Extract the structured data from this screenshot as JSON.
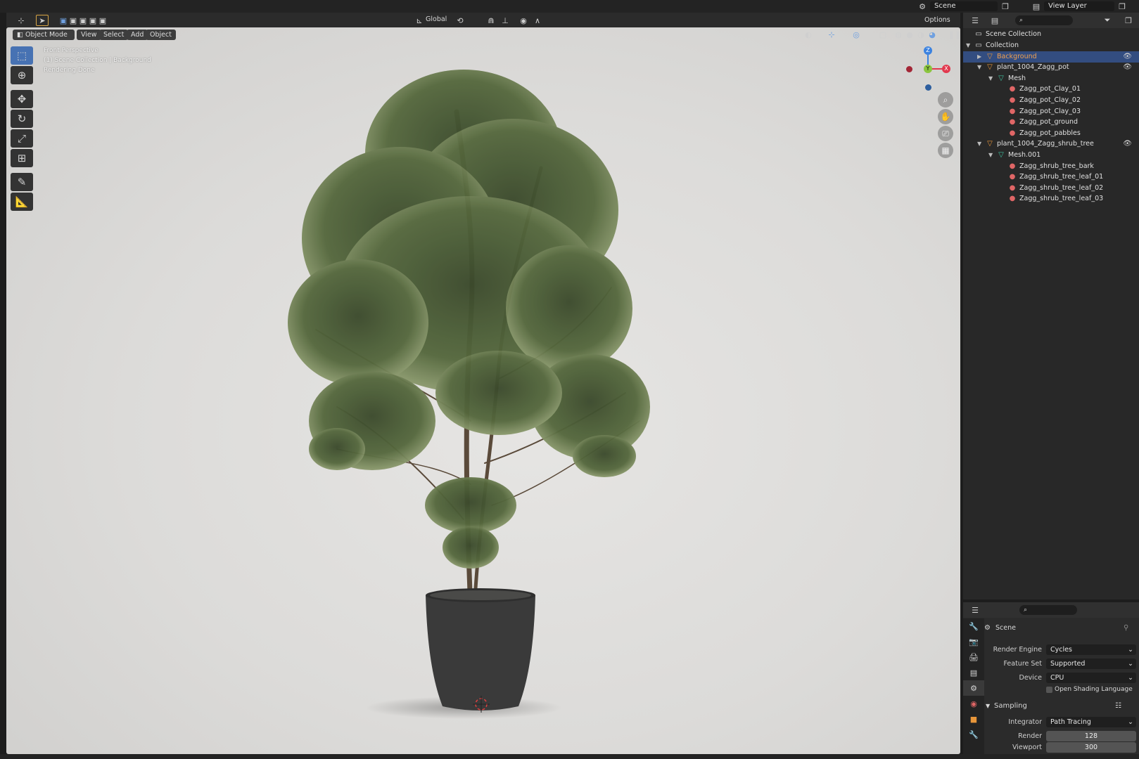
{
  "topbar": {
    "scene_label": "Scene",
    "view_layer_label": "View Layer"
  },
  "viewport_header": {
    "transform_orientation": "Global",
    "options_label": "Options",
    "mode_label": "Object Mode",
    "menus": [
      "View",
      "Select",
      "Add",
      "Object"
    ]
  },
  "viewport_overlay": {
    "view_name": "Front Perspective",
    "context": "(1) Scene Collection | Background",
    "status": "Rendering Done"
  },
  "gizmo": {
    "z": "Z",
    "y": "Y",
    "x": "X"
  },
  "outliner": {
    "root": "Scene Collection",
    "rows": [
      {
        "label": "Collection",
        "icon": "collection-icon",
        "indent": 1,
        "expanded": true
      },
      {
        "label": "Background",
        "icon": "object-icon",
        "indent": 2,
        "expanded": false,
        "selected": true
      },
      {
        "label": "plant_1004_Zagg_pot",
        "icon": "object-icon",
        "indent": 2,
        "expanded": true
      },
      {
        "label": "Mesh",
        "icon": "mesh-icon",
        "indent": 3,
        "expanded": true
      },
      {
        "label": "Zagg_pot_Clay_01",
        "icon": "material-icon",
        "indent": 4
      },
      {
        "label": "Zagg_pot_Clay_02",
        "icon": "material-icon",
        "indent": 4
      },
      {
        "label": "Zagg_pot_Clay_03",
        "icon": "material-icon",
        "indent": 4
      },
      {
        "label": "Zagg_pot_ground",
        "icon": "material-icon",
        "indent": 4
      },
      {
        "label": "Zagg_pot_pabbles",
        "icon": "material-icon",
        "indent": 4
      },
      {
        "label": "plant_1004_Zagg_shrub_tree",
        "icon": "object-icon",
        "indent": 2,
        "expanded": true
      },
      {
        "label": "Mesh.001",
        "icon": "mesh-icon",
        "indent": 3,
        "expanded": true
      },
      {
        "label": "Zagg_shrub_tree_bark",
        "icon": "material-icon",
        "indent": 4
      },
      {
        "label": "Zagg_shrub_tree_leaf_01",
        "icon": "material-icon",
        "indent": 4
      },
      {
        "label": "Zagg_shrub_tree_leaf_02",
        "icon": "material-icon",
        "indent": 4
      },
      {
        "label": "Zagg_shrub_tree_leaf_03",
        "icon": "material-icon",
        "indent": 4
      }
    ]
  },
  "properties": {
    "context_title": "Scene",
    "render_engine_label": "Render Engine",
    "render_engine_value": "Cycles",
    "feature_set_label": "Feature Set",
    "feature_set_value": "Supported",
    "device_label": "Device",
    "device_value": "CPU",
    "osl_label": "Open Shading Language",
    "sampling_label": "Sampling",
    "integrator_label": "Integrator",
    "integrator_value": "Path Tracing",
    "render_label": "Render",
    "render_value": "128",
    "viewport_label": "Viewport",
    "viewport_value": "300"
  },
  "colors": {
    "selection": "#334d80",
    "active_tool": "#4772b3",
    "object_icon": "#e8963a",
    "mesh_icon": "#3fc2a0",
    "material_icon": "#e06666",
    "gizmo_x": "#e2394e",
    "gizmo_y": "#8bc53f",
    "gizmo_z": "#3b82e0"
  }
}
